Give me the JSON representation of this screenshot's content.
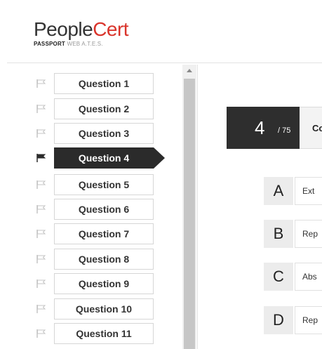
{
  "logo": {
    "brand_part1": "People",
    "brand_part2": "Cert",
    "sub_bold": "PASSPORT",
    "sub_gray": " WEB A.T.E.S."
  },
  "questions": [
    {
      "label": "Question 1",
      "flagged": false,
      "active": false
    },
    {
      "label": "Question 2",
      "flagged": false,
      "active": false
    },
    {
      "label": "Question 3",
      "flagged": false,
      "active": false
    },
    {
      "label": "Question 4",
      "flagged": true,
      "active": true
    },
    {
      "label": "Question 5",
      "flagged": false,
      "active": false
    },
    {
      "label": "Question 6",
      "flagged": false,
      "active": false
    },
    {
      "label": "Question 7",
      "flagged": false,
      "active": false
    },
    {
      "label": "Question 8",
      "flagged": false,
      "active": false
    },
    {
      "label": "Question 9",
      "flagged": false,
      "active": false
    },
    {
      "label": "Question 10",
      "flagged": false,
      "active": false
    },
    {
      "label": "Question 11",
      "flagged": false,
      "active": false
    }
  ],
  "icons": {
    "flag": "flag-icon",
    "scroll_up": "chevron-up-icon"
  },
  "counter": {
    "current": "4",
    "total": "/ 75"
  },
  "question_title_fragment": "Co",
  "options": [
    {
      "letter": "A",
      "text": "Ext"
    },
    {
      "letter": "B",
      "text": "Rep"
    },
    {
      "letter": "C",
      "text": "Abs"
    },
    {
      "letter": "D",
      "text": "Rep"
    }
  ],
  "colors": {
    "brand_red": "#d9342b",
    "active_question_bg": "#2b2b2b",
    "counter_bg": "#2e2e2e",
    "option_letter_bg": "#ececec"
  }
}
